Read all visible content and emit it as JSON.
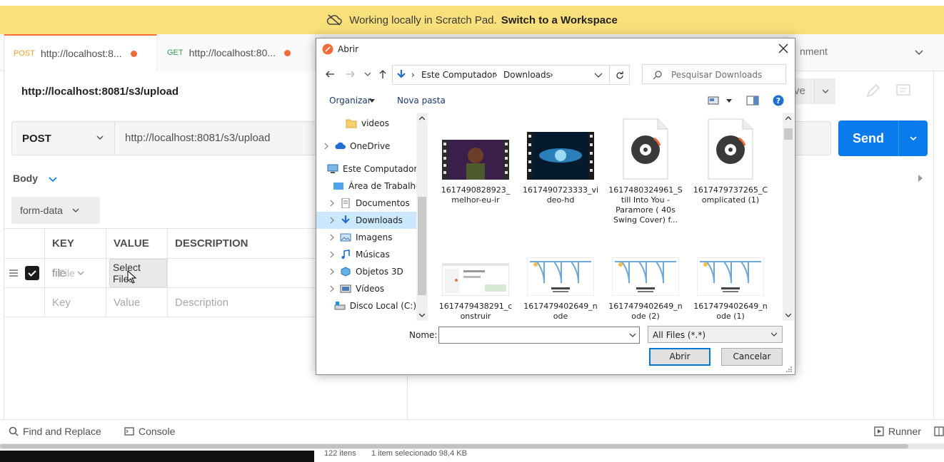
{
  "banner": {
    "text": "Working locally in Scratch Pad.",
    "link": "Switch to a Workspace"
  },
  "tabs": [
    {
      "method": "POST",
      "title": "http://localhost:8..."
    },
    {
      "method": "GET",
      "title": "http://localhost:80..."
    }
  ],
  "environment": {
    "label": "nment"
  },
  "request": {
    "title": "http://localhost:8081/s3/upload",
    "method": "POST",
    "url": "http://localhost:8081/s3/upload",
    "send_label": "Send",
    "save_label": "ve"
  },
  "body": {
    "tab_label": "Body",
    "mode": "form-data",
    "columns": [
      "KEY",
      "VALUE",
      "DESCRIPTION"
    ],
    "row": {
      "key": "file",
      "type_label": "File",
      "select_files": "Select Files"
    },
    "placeholders": {
      "key": "Key",
      "value": "Value",
      "description": "Description"
    }
  },
  "footer": {
    "find_replace": "Find and Replace",
    "console": "Console",
    "runner": "Runner"
  },
  "statusbar": {
    "count": "122 itens",
    "selected": "1 item selecionado  98,4 KB"
  },
  "dialog": {
    "title": "Abrir",
    "breadcrumb": [
      "Este Computador",
      "Downloads"
    ],
    "search_placeholder": "Pesquisar Downloads",
    "organize": "Organizar",
    "new_folder": "Nova pasta",
    "tree": [
      {
        "label": "videos",
        "icon": "folder-icon"
      },
      {
        "label": "OneDrive",
        "icon": "cloud-icon"
      },
      {
        "label": "Este Computador",
        "icon": "computer-icon"
      },
      {
        "label": "Área de Trabalho",
        "icon": "desktop-icon"
      },
      {
        "label": "Documentos",
        "icon": "document-icon"
      },
      {
        "label": "Downloads",
        "icon": "download-icon"
      },
      {
        "label": "Imagens",
        "icon": "image-icon"
      },
      {
        "label": "Músicas",
        "icon": "music-icon"
      },
      {
        "label": "Objetos 3D",
        "icon": "cube-icon"
      },
      {
        "label": "Vídeos",
        "icon": "video-icon"
      },
      {
        "label": "Disco Local (C:)",
        "icon": "drive-icon"
      }
    ],
    "files": [
      {
        "line1": "1617490828923_",
        "line2": "melhor-eu-ir",
        "line3": "",
        "line4": "",
        "kind": "video-thumb"
      },
      {
        "line1": "1617490723333_vi",
        "line2": "deo-hd",
        "line3": "",
        "line4": "",
        "kind": "video-thumb-2"
      },
      {
        "line1": "1617480324961_S",
        "line2": "till Into You -",
        "line3": "Paramore ( 40s",
        "line4": "Swing Cover) f...",
        "kind": "audio-file"
      },
      {
        "line1": "1617479737265_C",
        "line2": "omplicated (1)",
        "line3": "",
        "line4": "",
        "kind": "audio-file"
      },
      {
        "line1": "1617479438291_c",
        "line2": "onstruir",
        "line3": "",
        "line4": "",
        "kind": "screenshot-thumb"
      },
      {
        "line1": "1617479402649_n",
        "line2": "ode",
        "line3": "",
        "line4": "",
        "kind": "diagram-thumb"
      },
      {
        "line1": "1617479402649_n",
        "line2": "ode (2)",
        "line3": "",
        "line4": "",
        "kind": "diagram-thumb"
      },
      {
        "line1": "1617479402649_n",
        "line2": "ode (1)",
        "line3": "",
        "line4": "",
        "kind": "diagram-thumb"
      }
    ],
    "name_label": "Nome:",
    "name_value": "",
    "file_type": "All Files (*.*)",
    "open_label": "Abrir",
    "cancel_label": "Cancelar"
  }
}
